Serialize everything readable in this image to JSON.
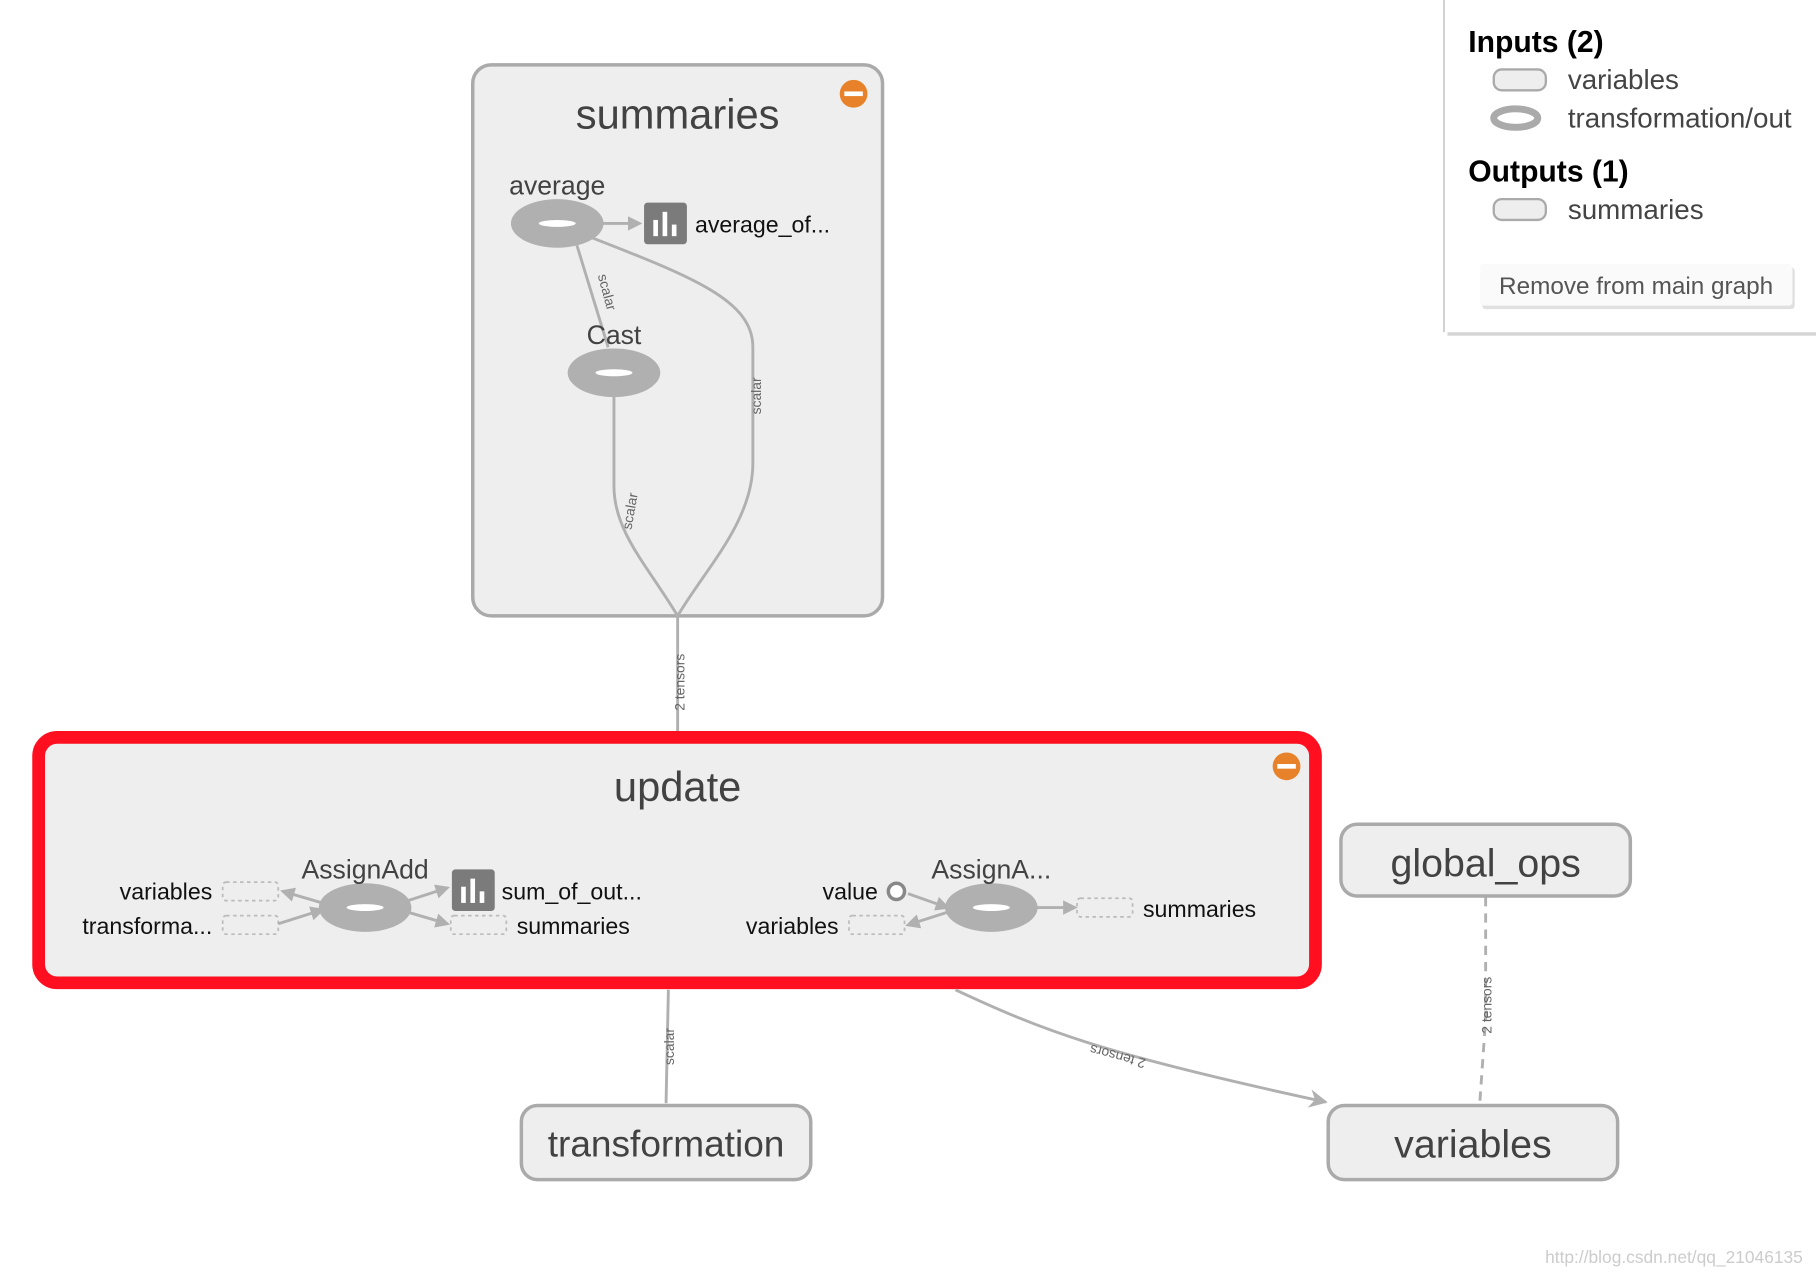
{
  "colors": {
    "highlight": "#ff0f1f",
    "group_fill": "#eeeeee",
    "group_stroke": "#aaaaaa",
    "op_fill": "#b0b0b0",
    "summary_icon": "#7b7b7b",
    "collapse_button": "#e8822a"
  },
  "graph": {
    "summaries": {
      "title": "summaries",
      "average": "average",
      "average_of": "average_of...",
      "cast": "Cast",
      "edge_avg_cast": "scalar",
      "edge_avg_out": "scalar",
      "edge_cast_out": "scalar",
      "collapse_icon": "minus-circle-icon"
    },
    "edge_summaries_update": "2 tensors",
    "update": {
      "title": "update",
      "assignadd": "AssignAdd",
      "in_variables": "variables",
      "in_transformation": "transforma...",
      "out_sum": "sum_of_out...",
      "out_summaries": "summaries",
      "assigna": "AssignA...",
      "value": "value",
      "in2_variables": "variables",
      "out2_summaries": "summaries",
      "collapse_icon": "minus-circle-icon"
    },
    "global_ops": "global_ops",
    "transformation": "transformation",
    "variables": "variables",
    "edge_update_transformation": "scalar",
    "edge_update_variables": "2 tensors",
    "edge_global_variables": "2 tensors"
  },
  "panel": {
    "inputs_title": "Inputs (2)",
    "inputs": [
      "variables",
      "transformation/out"
    ],
    "outputs_title": "Outputs (1)",
    "outputs": [
      "summaries"
    ],
    "remove_button": "Remove from main graph"
  },
  "watermark": "http://blog.csdn.net/qq_21046135"
}
